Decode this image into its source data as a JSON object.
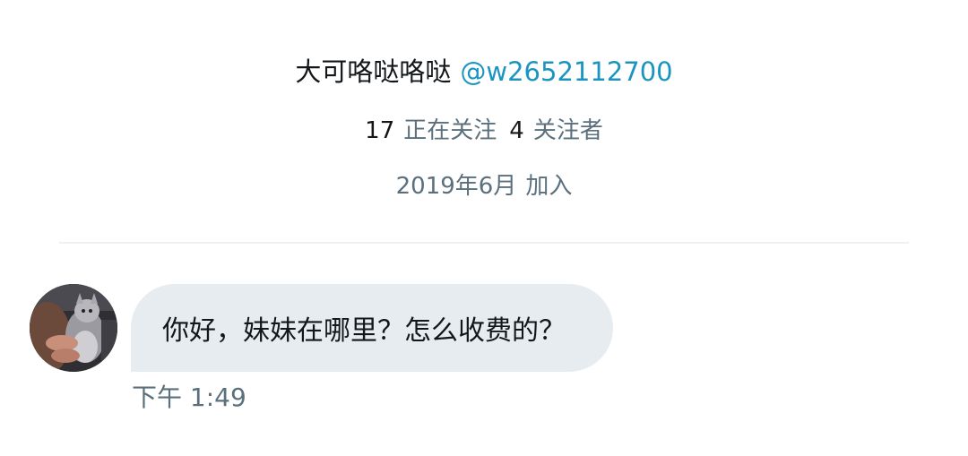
{
  "profile": {
    "display_name": "大可咯哒咯哒",
    "handle": "@w2652112700",
    "following_count": "17",
    "following_label": "正在关注",
    "followers_count": "4",
    "followers_label": "关注者",
    "joined_date": "2019年6月",
    "joined_label": "加入"
  },
  "conversation": {
    "messages": [
      {
        "text": "你好，妹妹在哪里？怎么收费的？",
        "time": "下午 1:49"
      }
    ]
  },
  "colors": {
    "handle": "#1b95c0",
    "secondary_text": "#5b6f7d",
    "bubble_background": "#e6ecf0",
    "primary_text": "#14171a"
  }
}
